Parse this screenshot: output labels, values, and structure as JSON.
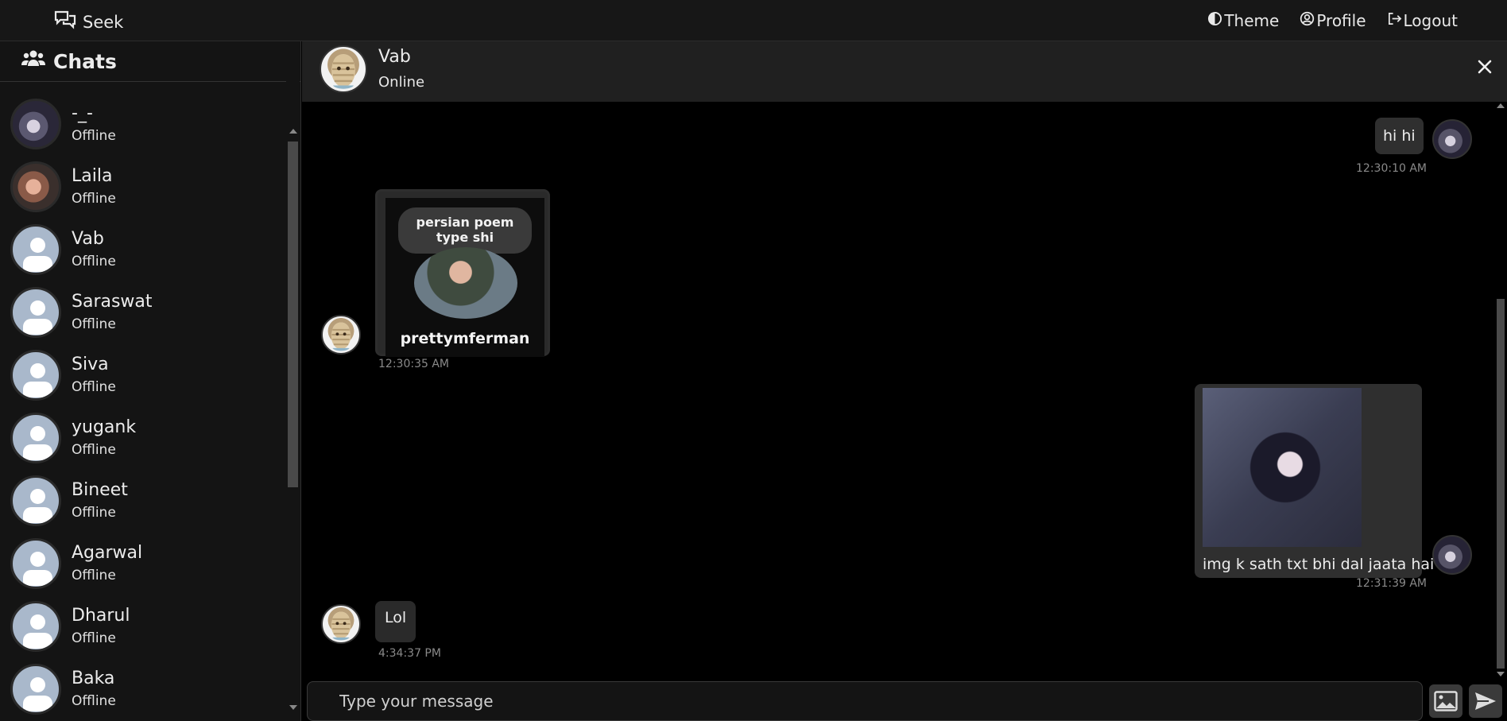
{
  "navbar": {
    "brand": "Seek",
    "links": {
      "theme": "Theme",
      "profile": "Profile",
      "logout": "Logout"
    }
  },
  "sidebar": {
    "title": "Chats",
    "contacts": [
      {
        "name": "-_-",
        "status": "Offline",
        "avatar": "anime"
      },
      {
        "name": "Laila",
        "status": "Offline",
        "avatar": "photo"
      },
      {
        "name": "Vab",
        "status": "Offline",
        "avatar": "default"
      },
      {
        "name": "Saraswat",
        "status": "Offline",
        "avatar": "default"
      },
      {
        "name": "Siva",
        "status": "Offline",
        "avatar": "default"
      },
      {
        "name": "yugank",
        "status": "Offline",
        "avatar": "default"
      },
      {
        "name": "Bineet",
        "status": "Offline",
        "avatar": "default"
      },
      {
        "name": "Agarwal",
        "status": "Offline",
        "avatar": "default"
      },
      {
        "name": "Dharul",
        "status": "Offline",
        "avatar": "default"
      },
      {
        "name": "Baka",
        "status": "Offline",
        "avatar": "default"
      }
    ]
  },
  "chat": {
    "peer_name": "Vab",
    "peer_status": "Online",
    "messages": [
      {
        "direction": "out",
        "text": "hi hi",
        "time": "12:30:10 AM"
      },
      {
        "direction": "in",
        "image_text": "persian poem type shi",
        "image_caption": "prettymferman",
        "time": "12:30:35 AM"
      },
      {
        "direction": "out",
        "text": "img k sath txt bhi dal jaata hai",
        "time": "12:31:39 AM"
      },
      {
        "direction": "in",
        "text": "Lol",
        "time": "4:34:37 PM"
      }
    ]
  },
  "composer": {
    "placeholder": "Type your message"
  },
  "colors": {
    "background": "#000000",
    "navbar": "#171717",
    "sidebar": "#141414",
    "bubble": "#2f2f2f"
  },
  "icons": {
    "brand": "chat-bubbles-icon",
    "theme": "half-circle-icon",
    "profile": "user-circle-icon",
    "logout": "logout-arrow-icon",
    "chats": "users-group-icon",
    "close": "close-icon",
    "attach": "image-icon",
    "send": "send-icon"
  }
}
